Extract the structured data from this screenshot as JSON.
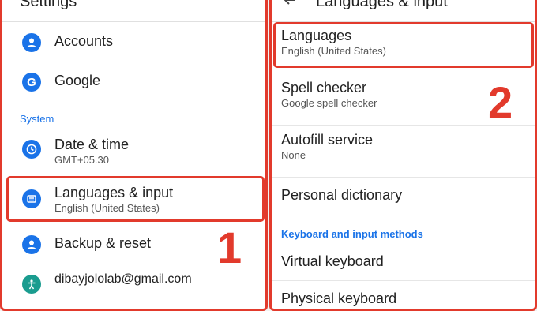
{
  "left_panel": {
    "header_title": "Settings",
    "items": [
      {
        "title": "Accounts"
      },
      {
        "title": "Google"
      },
      {
        "title": "Date & time",
        "subtitle": "GMT+05.30"
      },
      {
        "title": "Languages & input",
        "subtitle": "English (United States)"
      },
      {
        "title": "Backup & reset"
      },
      {
        "title": "dibayjololab@gmail.com"
      }
    ],
    "section_label": "System",
    "step_number": "1"
  },
  "right_panel": {
    "header_title": "Languages & input",
    "items": [
      {
        "title": "Languages",
        "subtitle": "English (United States)"
      },
      {
        "title": "Spell checker",
        "subtitle": "Google spell checker"
      },
      {
        "title": "Autofill service",
        "subtitle": "None"
      },
      {
        "title": "Personal dictionary"
      },
      {
        "title": "Virtual keyboard"
      },
      {
        "title": "Physical keyboard"
      }
    ],
    "section_label": "Keyboard and input methods",
    "step_number": "2"
  },
  "colors": {
    "accent": "#1a73e8",
    "highlight": "#e23a2c"
  },
  "icons": [
    "account-icon",
    "google-icon",
    "clock-icon",
    "keyboard-icon",
    "backup-icon",
    "accessibility-icon",
    "back-arrow-icon"
  ]
}
